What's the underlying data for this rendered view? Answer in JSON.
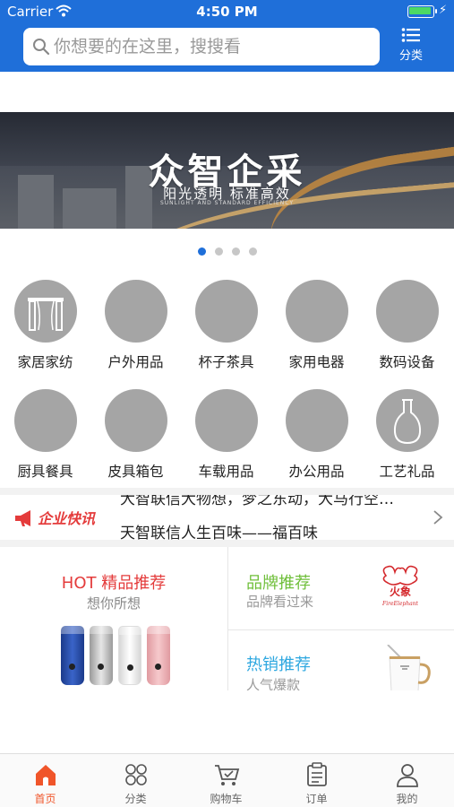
{
  "status_bar": {
    "carrier": "Carrier",
    "time": "4:50 PM",
    "battery_level": 1.0
  },
  "search": {
    "placeholder": "你想要的在这里，搜搜看",
    "category_label": "分类"
  },
  "banner": {
    "title": "众智企采",
    "subtitle": "阳光透明   标准高效",
    "subtitle_en": "SUNLIGHT AND STANDARD EFFICIENCY",
    "page_count": 4,
    "active_page": 1
  },
  "categories": [
    {
      "label": "家居家纺",
      "icon": "home-textile-icon"
    },
    {
      "label": "户外用品",
      "icon": "placeholder-icon"
    },
    {
      "label": "杯子茶具",
      "icon": "placeholder-icon"
    },
    {
      "label": "家用电器",
      "icon": "placeholder-icon"
    },
    {
      "label": "数码设备",
      "icon": "placeholder-icon"
    },
    {
      "label": "厨具餐具",
      "icon": "placeholder-icon"
    },
    {
      "label": "皮具箱包",
      "icon": "placeholder-icon"
    },
    {
      "label": "车载用品",
      "icon": "placeholder-icon"
    },
    {
      "label": "办公用品",
      "icon": "placeholder-icon"
    },
    {
      "label": "工艺礼品",
      "icon": "vase-icon"
    }
  ],
  "news": {
    "logo_text": "企业快讯",
    "headlines": [
      "大智联信大物想，梦之东动，大马行空…",
      "天智联信人生百味——福百味"
    ]
  },
  "recommendations": {
    "hot": {
      "title": "HOT  精品推荐",
      "subtitle": "想你所想"
    },
    "brand": {
      "title": "品牌推荐",
      "subtitle": "品牌看过来",
      "logo_text": "火象",
      "logo_sub": "FireElephant"
    },
    "hot_sale": {
      "title": "热销推荐",
      "subtitle": "人气爆款"
    }
  },
  "colors": {
    "primary": "#1f6fd9",
    "tab_active": "#f0552a",
    "hot": "#e43b3b",
    "brand": "#6fbf3a",
    "hot_sale": "#2fa8e0"
  },
  "tabbar": [
    {
      "label": "首页",
      "icon": "home-icon",
      "active": true
    },
    {
      "label": "分类",
      "icon": "category-grid-icon",
      "active": false
    },
    {
      "label": "购物车",
      "icon": "cart-icon",
      "active": false
    },
    {
      "label": "订单",
      "icon": "order-list-icon",
      "active": false
    },
    {
      "label": "我的",
      "icon": "user-icon",
      "active": false
    }
  ]
}
